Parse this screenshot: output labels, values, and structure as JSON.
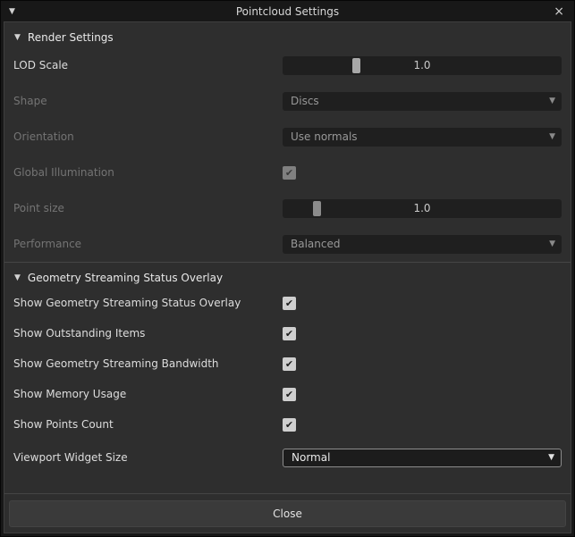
{
  "window": {
    "title": "Pointcloud Settings",
    "collapse_icon": "▼",
    "close_icon": "×"
  },
  "icons": {
    "section_triangle": "▼",
    "dropdown_arrow": "▼",
    "check": "✔"
  },
  "colors": {
    "panel_bg": "#2e2e2e",
    "control_bg": "#1f1f1f",
    "slider_handle": "#a8a8a8",
    "enabled_text": "#dddddd",
    "disabled_text": "#747474"
  },
  "sections": {
    "render": {
      "title": "Render Settings",
      "rows": {
        "lod_scale": {
          "label": "LOD Scale",
          "value": "1.0",
          "handle_style": "left: 25%"
        },
        "shape": {
          "label": "Shape",
          "value": "Discs"
        },
        "orientation": {
          "label": "Orientation",
          "value": "Use normals"
        },
        "global_illumination": {
          "label": "Global Illumination",
          "checked": true
        },
        "point_size": {
          "label": "Point size",
          "value": "1.0",
          "handle_style": "left: 11%"
        },
        "performance": {
          "label": "Performance",
          "value": "Balanced"
        }
      }
    },
    "overlay": {
      "title": "Geometry Streaming Status Overlay",
      "rows": {
        "show_overlay": {
          "label": "Show Geometry Streaming Status Overlay",
          "checked": true
        },
        "show_outstanding": {
          "label": "Show Outstanding Items",
          "checked": true
        },
        "show_bandwidth": {
          "label": "Show Geometry Streaming Bandwidth",
          "checked": true
        },
        "show_memory": {
          "label": "Show Memory Usage",
          "checked": true
        },
        "show_points": {
          "label": "Show Points Count",
          "checked": true
        },
        "widget_size": {
          "label": "Viewport Widget Size",
          "value": "Normal"
        }
      }
    }
  },
  "footer": {
    "close_label": "Close"
  }
}
